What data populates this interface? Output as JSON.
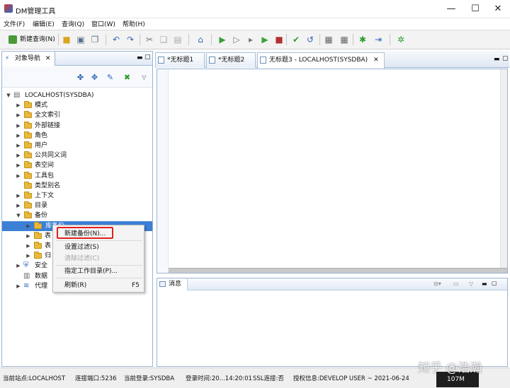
{
  "window": {
    "title": "DM管理工具",
    "minimize": "—",
    "maximize": "☐",
    "close": "✕"
  },
  "menu": [
    "文件(F)",
    "编辑(E)",
    "查询(Q)",
    "窗口(W)",
    "帮助(H)"
  ],
  "toolbar": {
    "new_query_label": "新建查询(N)"
  },
  "left_panel": {
    "tab_label": "对象导航",
    "tab_close": "✕",
    "tree": [
      {
        "label": "LOCALHOST(SYSDBA)",
        "level": 0,
        "expanded": true,
        "type": "server"
      },
      {
        "label": "模式",
        "level": 1,
        "type": "folder"
      },
      {
        "label": "全文索引",
        "level": 1,
        "type": "folder"
      },
      {
        "label": "外部链接",
        "level": 1,
        "type": "folder"
      },
      {
        "label": "角色",
        "level": 1,
        "type": "folder"
      },
      {
        "label": "用户",
        "level": 1,
        "type": "folder"
      },
      {
        "label": "公共同义词",
        "level": 1,
        "type": "folder"
      },
      {
        "label": "表空间",
        "level": 1,
        "type": "folder"
      },
      {
        "label": "工具包",
        "level": 1,
        "type": "folder"
      },
      {
        "label": "类型别名",
        "level": 1,
        "type": "folder",
        "no_twisty": true
      },
      {
        "label": "上下文",
        "level": 1,
        "type": "folder"
      },
      {
        "label": "目录",
        "level": 1,
        "type": "folder"
      },
      {
        "label": "备份",
        "level": 1,
        "expanded": true,
        "type": "folder"
      },
      {
        "label": "库备份",
        "level": 2,
        "selected": true,
        "type": "folder"
      },
      {
        "label": "表",
        "level": 2,
        "type": "folder"
      },
      {
        "label": "表",
        "level": 2,
        "type": "folder"
      },
      {
        "label": "归",
        "level": 2,
        "type": "folder"
      },
      {
        "label": "安全",
        "level": 1,
        "type": "shield"
      },
      {
        "label": "数据",
        "level": 1,
        "type": "db",
        "no_twisty": true
      },
      {
        "label": "代理",
        "level": 1,
        "type": "stack"
      }
    ]
  },
  "context_menu": {
    "items": [
      {
        "label": "新建备份(N)...",
        "disabled": false
      },
      {
        "label": "设置过滤(S)",
        "disabled": false
      },
      {
        "label": "清除过滤(C)",
        "disabled": true
      },
      {
        "label": "指定工作目录(P)...",
        "disabled": false
      },
      {
        "label": "刷新(R)",
        "shortcut": "F5",
        "disabled": false
      }
    ]
  },
  "editor_tabs": [
    {
      "label": "*无标题1",
      "active": false
    },
    {
      "label": "*无标题2",
      "active": false
    },
    {
      "label": "无标题3 - LOCALHOST(SYSDBA)",
      "active": true,
      "close": "✕"
    }
  ],
  "message_panel": {
    "tab_label": "消息"
  },
  "status_bar": {
    "site": "当前站点:LOCALHOST",
    "port": "连接端口:5236",
    "login": "当前登录:SYSDBA",
    "login_time": "登录时间:20...14:20:01",
    "ssl": "SSL连接:否",
    "license": "授权信息:DEVELOP USER ~ 2021-06-24",
    "memory": "107M"
  },
  "watermark": "知乎 @浩瀚"
}
